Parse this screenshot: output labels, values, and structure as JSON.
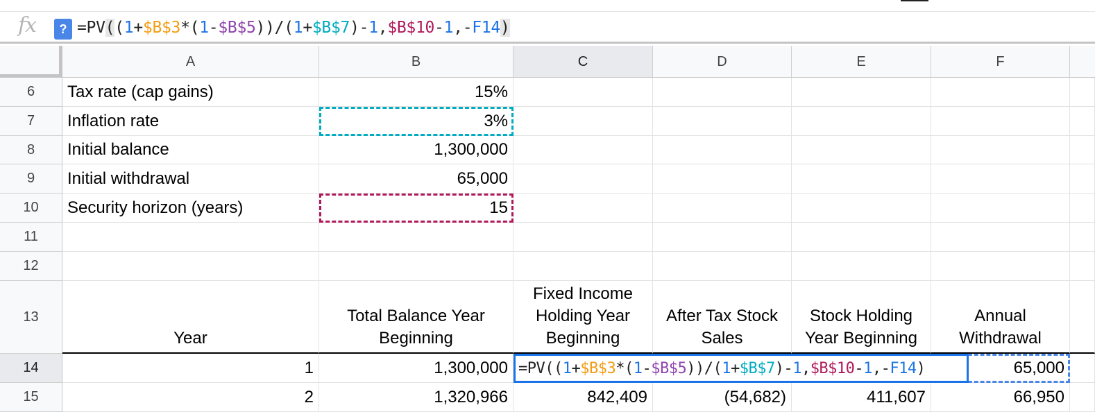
{
  "formula_bar": {
    "fx_label": "fx",
    "help_label": "?",
    "tokens": [
      {
        "t": "=PV",
        "c": "dark"
      },
      {
        "t": "(",
        "c": "dark",
        "hl": true
      },
      {
        "t": "(",
        "c": "dark"
      },
      {
        "t": "1",
        "c": "num"
      },
      {
        "t": "+",
        "c": "dark"
      },
      {
        "t": "$B$3",
        "c": "orange"
      },
      {
        "t": "*(",
        "c": "dark"
      },
      {
        "t": "1",
        "c": "num"
      },
      {
        "t": "-",
        "c": "dark"
      },
      {
        "t": "$B$5",
        "c": "purple"
      },
      {
        "t": "))/(",
        "c": "dark"
      },
      {
        "t": "1",
        "c": "num"
      },
      {
        "t": "+",
        "c": "dark"
      },
      {
        "t": "$B$7",
        "c": "cyan"
      },
      {
        "t": ")-",
        "c": "dark"
      },
      {
        "t": "1",
        "c": "num"
      },
      {
        "t": ",",
        "c": "dark"
      },
      {
        "t": "$B$10",
        "c": "magenta"
      },
      {
        "t": "-",
        "c": "dark"
      },
      {
        "t": "1",
        "c": "num"
      },
      {
        "t": ",-",
        "c": "dark"
      },
      {
        "t": "F14",
        "c": "blue"
      },
      {
        "t": ")",
        "c": "dark",
        "hl": true
      }
    ]
  },
  "columns": [
    "A",
    "B",
    "C",
    "D",
    "E",
    "F"
  ],
  "rows": {
    "r6": {
      "num": "6",
      "a": "Tax rate (cap gains)",
      "b": "15%"
    },
    "r7": {
      "num": "7",
      "a": "Inflation rate",
      "b": "3%"
    },
    "r8": {
      "num": "8",
      "a": "Initial balance",
      "b": "1,300,000"
    },
    "r9": {
      "num": "9",
      "a": "Initial withdrawal",
      "b": "65,000"
    },
    "r10": {
      "num": "10",
      "a": "Security horizon (years)",
      "b": "15"
    },
    "r11": {
      "num": "11"
    },
    "r12": {
      "num": "12"
    },
    "r13": {
      "num": "13",
      "a": "Year",
      "b": "Total Balance Year Beginning",
      "c": "Fixed Income Holding Year Beginning",
      "d": "After Tax Stock Sales",
      "e": "Stock Holding Year Beginning",
      "f": "Annual Withdrawal"
    },
    "r14": {
      "num": "14",
      "a": "1",
      "b": "1,300,000",
      "f": "65,000"
    },
    "r15": {
      "num": "15",
      "a": "2",
      "b": "1,320,966",
      "c": "842,409",
      "d": "(54,682)",
      "e": "411,607",
      "f": "66,950"
    }
  }
}
